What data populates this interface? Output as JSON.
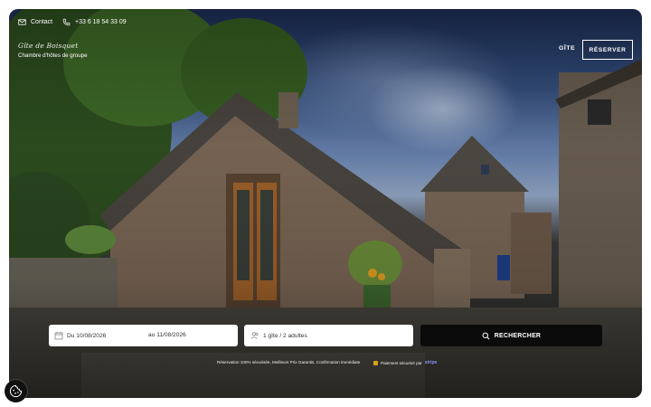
{
  "topbar": {
    "contact_label": "Contact",
    "phone": "+33 6 18 54 33 09"
  },
  "brand": {
    "logo_text": "Gîte de Boisquet",
    "tagline": "Chambre d'hôtes de groupe"
  },
  "nav": {
    "gite_label": "GÎTE",
    "reserve_label": "RÉSERVER"
  },
  "search": {
    "from_label": "Du",
    "from_date": "10/08/2026",
    "to_label": "au",
    "to_date": "11/08/2026",
    "guests": "1 gîte / 2 adultes",
    "button_label": "RECHERCHER"
  },
  "footer": {
    "assurances": "Réservation 100% sécurisée, Meilleurs Prix Garantis, Confirmation immédiate",
    "payment": "Paiement sécurisé par",
    "payment_brand": "stripe"
  },
  "icons": {
    "mail": "mail-icon",
    "phone": "phone-icon",
    "calendar": "calendar-icon",
    "guests": "guests-icon",
    "search": "search-icon",
    "lock": "lock-icon",
    "cookie": "cookie-settings-icon"
  },
  "colors": {
    "accent": "#0b0b0b",
    "stripe": "#8a8ff5",
    "lock": "#d9a21e"
  }
}
